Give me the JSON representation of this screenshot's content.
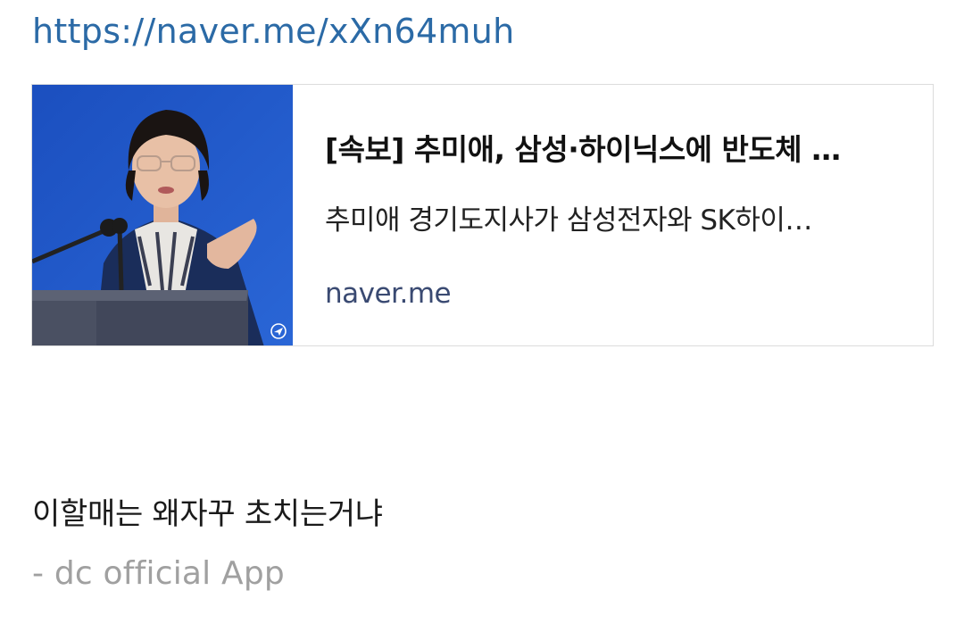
{
  "post": {
    "link_url": "https://naver.me/xXn64muh",
    "preview": {
      "title": "[속보] 추미애, 삼성·하이닉스에 반도체 …",
      "description": "추미애 경기도지사가 삼성전자와 SK하이…",
      "domain": "naver.me",
      "thumbnail_icon": "news-photo-podium-speaker",
      "watermark_icon": "news-agency-logo-icon"
    },
    "body_text": "이할매는 왜자꾸 초치는거냐",
    "signature": "- dc official App"
  },
  "colors": {
    "link": "#2b6aa6",
    "card_border": "#dcdcdc",
    "domain": "#3a4a72",
    "signature": "#a0a0a0",
    "thumbnail_bg": "#1e57c4"
  }
}
